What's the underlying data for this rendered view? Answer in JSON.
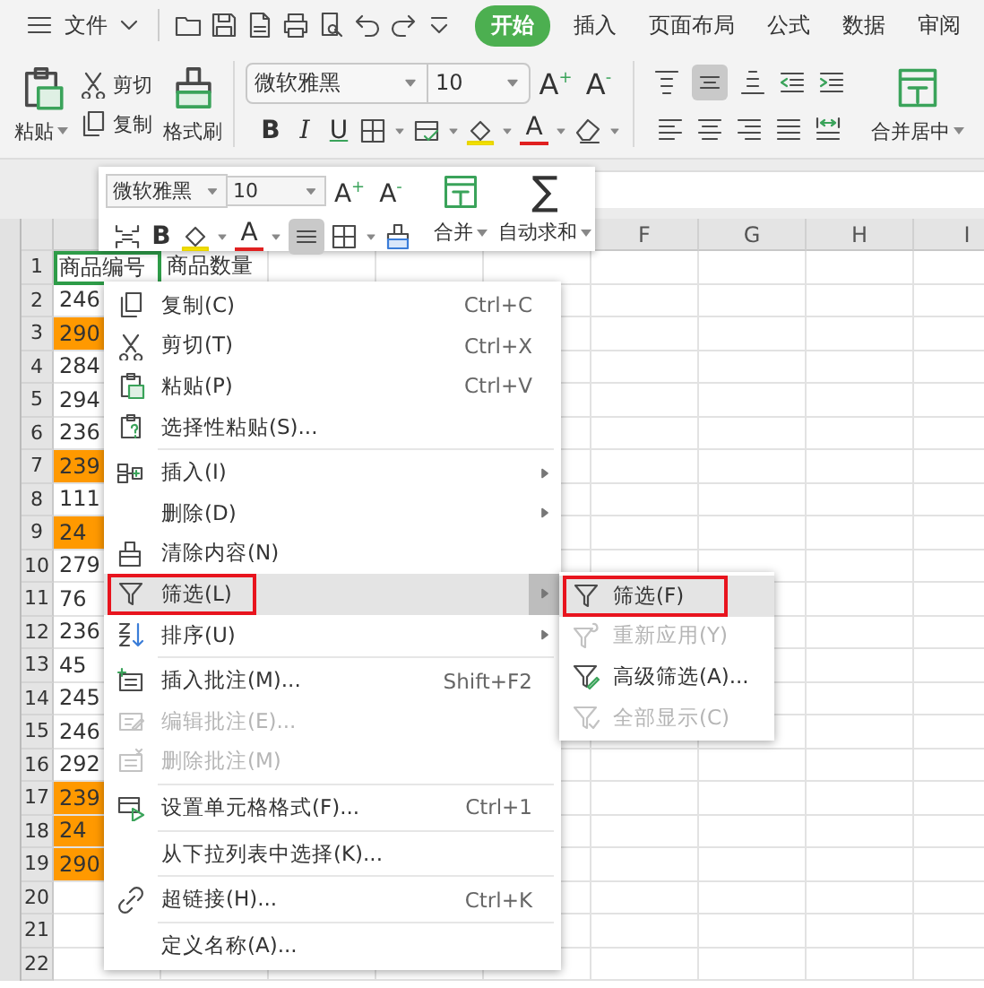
{
  "top_bar": {
    "file_menu": "文件",
    "tabs": [
      {
        "label": "开始",
        "selected": true
      },
      {
        "label": "插入",
        "selected": false
      },
      {
        "label": "页面布局",
        "selected": false
      },
      {
        "label": "公式",
        "selected": false
      },
      {
        "label": "数据",
        "selected": false
      },
      {
        "label": "审阅",
        "selected": false
      }
    ]
  },
  "ribbon": {
    "paste": "粘贴",
    "cut": "剪切",
    "copy": "复制",
    "format_painter": "格式刷",
    "font": "微软雅黑",
    "font_size": "10",
    "grow_font": "A$^{+}$",
    "shrink_font": "A$^{-}$",
    "bold": "B",
    "italic": "I",
    "underline": "U",
    "font_color": "A",
    "merge_center": "合并居中"
  },
  "mini_toolbar": {
    "font": "微软雅黑",
    "font_size": "10",
    "grow_font": "A$^{+}$",
    "shrink_font": "A$^{-}$",
    "bold": "B",
    "font_color": "A",
    "merge": "合并",
    "autosum_symbol": "∑",
    "autosum": "自动求和"
  },
  "sheet": {
    "columns": [
      "F",
      "G",
      "H",
      "I"
    ],
    "rows": [
      {
        "number": "1",
        "cells": [
          {
            "text": "商品编号",
            "selected": true,
            "highlighted": false
          },
          {
            "text": "商品数量",
            "selected": false,
            "highlighted": false
          }
        ]
      },
      {
        "number": "2",
        "cells": [
          {
            "text": "246",
            "selected": false,
            "highlighted": false
          }
        ]
      },
      {
        "number": "3",
        "cells": [
          {
            "text": "290",
            "selected": false,
            "highlighted": true
          }
        ]
      },
      {
        "number": "4",
        "cells": [
          {
            "text": "284",
            "selected": false,
            "highlighted": false
          }
        ]
      },
      {
        "number": "5",
        "cells": [
          {
            "text": "294",
            "selected": false,
            "highlighted": false
          }
        ]
      },
      {
        "number": "6",
        "cells": [
          {
            "text": "236",
            "selected": false,
            "highlighted": false
          }
        ]
      },
      {
        "number": "7",
        "cells": [
          {
            "text": "239",
            "selected": false,
            "highlighted": true
          }
        ]
      },
      {
        "number": "8",
        "cells": [
          {
            "text": "111",
            "selected": false,
            "highlighted": false
          }
        ]
      },
      {
        "number": "9",
        "cells": [
          {
            "text": "24",
            "selected": false,
            "highlighted": true
          }
        ]
      },
      {
        "number": "10",
        "cells": [
          {
            "text": "279",
            "selected": false,
            "highlighted": false
          }
        ]
      },
      {
        "number": "11",
        "cells": [
          {
            "text": "76",
            "selected": false,
            "highlighted": false
          }
        ]
      },
      {
        "number": "12",
        "cells": [
          {
            "text": "236",
            "selected": false,
            "highlighted": false
          }
        ]
      },
      {
        "number": "13",
        "cells": [
          {
            "text": "45",
            "selected": false,
            "highlighted": false
          }
        ]
      },
      {
        "number": "14",
        "cells": [
          {
            "text": "245",
            "selected": false,
            "highlighted": false
          }
        ]
      },
      {
        "number": "15",
        "cells": [
          {
            "text": "246",
            "selected": false,
            "highlighted": false
          }
        ]
      },
      {
        "number": "16",
        "cells": [
          {
            "text": "292",
            "selected": false,
            "highlighted": false
          }
        ]
      },
      {
        "number": "17",
        "cells": [
          {
            "text": "239",
            "selected": false,
            "highlighted": true
          }
        ]
      },
      {
        "number": "18",
        "cells": [
          {
            "text": "24",
            "selected": false,
            "highlighted": true
          }
        ]
      },
      {
        "number": "19",
        "cells": [
          {
            "text": "290",
            "selected": false,
            "highlighted": true
          }
        ]
      },
      {
        "number": "20"
      },
      {
        "number": "21"
      },
      {
        "number": "22"
      }
    ]
  },
  "context_menu": {
    "items": [
      {
        "kind": "item",
        "label": "复制(C)",
        "shortcut": "Ctrl+C",
        "submenu": false,
        "disabled": false,
        "selected": false,
        "outlined": false
      },
      {
        "kind": "item",
        "label": "剪切(T)",
        "shortcut": "Ctrl+X",
        "submenu": false,
        "disabled": false,
        "selected": false,
        "outlined": false
      },
      {
        "kind": "item",
        "label": "粘贴(P)",
        "shortcut": "Ctrl+V",
        "submenu": false,
        "disabled": false,
        "selected": false,
        "outlined": false
      },
      {
        "kind": "item",
        "label": "选择性粘贴(S)...",
        "submenu": false,
        "disabled": false,
        "selected": false,
        "outlined": false
      },
      {
        "kind": "divider"
      },
      {
        "kind": "item",
        "label": "插入(I)",
        "submenu": true,
        "disabled": false,
        "selected": false,
        "outlined": false
      },
      {
        "kind": "item",
        "label": "删除(D)",
        "submenu": true,
        "disabled": false,
        "selected": false,
        "outlined": false
      },
      {
        "kind": "item",
        "label": "清除内容(N)",
        "submenu": false,
        "disabled": false,
        "selected": false,
        "outlined": false
      },
      {
        "kind": "item",
        "label": "筛选(L)",
        "submenu": true,
        "disabled": false,
        "selected": true,
        "outlined": true
      },
      {
        "kind": "item",
        "label": "排序(U)",
        "submenu": true,
        "disabled": false,
        "selected": false,
        "outlined": false
      },
      {
        "kind": "divider"
      },
      {
        "kind": "item",
        "label": "插入批注(M)...",
        "shortcut": "Shift+F2",
        "submenu": false,
        "disabled": false,
        "selected": false,
        "outlined": false
      },
      {
        "kind": "item",
        "label": "编辑批注(E)...",
        "submenu": false,
        "disabled": true,
        "selected": false,
        "outlined": false
      },
      {
        "kind": "item",
        "label": "删除批注(M)",
        "submenu": false,
        "disabled": true,
        "selected": false,
        "outlined": false
      },
      {
        "kind": "divider"
      },
      {
        "kind": "item",
        "label": "设置单元格格式(F)...",
        "shortcut": "Ctrl+1",
        "submenu": false,
        "disabled": false,
        "selected": false,
        "outlined": false
      },
      {
        "kind": "divider"
      },
      {
        "kind": "item",
        "label": "从下拉列表中选择(K)...",
        "submenu": false,
        "disabled": false,
        "selected": false,
        "outlined": false
      },
      {
        "kind": "divider"
      },
      {
        "kind": "item",
        "label": "超链接(H)...",
        "shortcut": "Ctrl+K",
        "submenu": false,
        "disabled": false,
        "selected": false,
        "outlined": false
      },
      {
        "kind": "divider"
      },
      {
        "kind": "item",
        "label": "定义名称(A)...",
        "submenu": false,
        "disabled": false,
        "selected": false,
        "outlined": false
      }
    ]
  },
  "filter_submenu": {
    "items": [
      {
        "label": "筛选(F)",
        "disabled": false,
        "selected": true,
        "outlined": true
      },
      {
        "label": "重新应用(Y)",
        "disabled": true,
        "selected": false,
        "outlined": false
      },
      {
        "label": "高级筛选(A)...",
        "disabled": false,
        "selected": false,
        "outlined": false
      },
      {
        "label": "全部显示(C)",
        "disabled": true,
        "selected": false,
        "outlined": false
      }
    ]
  }
}
